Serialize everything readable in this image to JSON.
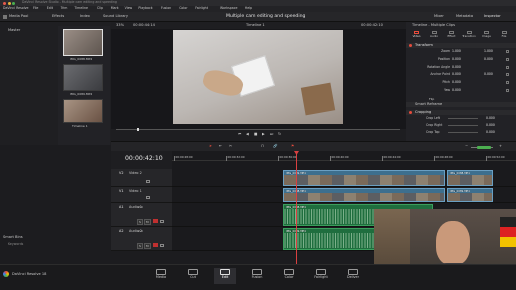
{
  "window": {
    "title": "DaVinci Resolve Studio - Multiple cam editing and speeding"
  },
  "menu": [
    "DaVinci Resolve",
    "File",
    "Edit",
    "Trim",
    "Timeline",
    "Clip",
    "Mark",
    "View",
    "Playback",
    "Fusion",
    "Color",
    "Fairlight",
    "Workspace",
    "Help"
  ],
  "toolbar": {
    "media_pool": "Media Pool",
    "effects": "Effects",
    "index": "Index",
    "sound_library": "Sound Library",
    "project_title": "Multiple cam editing and speeding",
    "mixer": "Mixer",
    "metadata": "Metadata",
    "inspector": "Inspector",
    "zoom": "33%",
    "src_tc": "00:00:44:14",
    "timeline_name": "Timeline 1",
    "rec_tc": "00:00:42:10",
    "inspector_target": "Timeline - Multiple Clips"
  },
  "media_pool": {
    "bin": "Master",
    "clips": [
      {
        "name": "IMG_0088.MP4"
      },
      {
        "name": "IMG_0089.MP4"
      },
      {
        "name": "Timeline 1"
      }
    ],
    "smart_bins": "Smart Bins",
    "smart_item": "Keywords"
  },
  "inspector": {
    "tabs": [
      "Video",
      "Audio",
      "Effect",
      "Transition",
      "Image",
      "File"
    ],
    "transform_header": "Transform",
    "fields": [
      {
        "label": "Zoom",
        "x": "1.000",
        "y": "1.000"
      },
      {
        "label": "Position",
        "x": "0.000",
        "y": "0.000"
      },
      {
        "label": "Rotation Angle",
        "x": "0.000",
        "y": ""
      },
      {
        "label": "Anchor Point",
        "x": "0.000",
        "y": "0.000"
      },
      {
        "label": "Pitch",
        "x": "0.000",
        "y": ""
      },
      {
        "label": "Yaw",
        "x": "0.000",
        "y": ""
      }
    ],
    "flip": "Flip",
    "smart_reframe": "Smart Reframe",
    "cropping_header": "Cropping",
    "crops": [
      {
        "label": "Crop Left",
        "v": "0.000"
      },
      {
        "label": "Crop Right",
        "v": "0.000"
      },
      {
        "label": "Crop Top",
        "v": "0.000"
      }
    ]
  },
  "timeline": {
    "timecode": "00:00:42:10",
    "ruler": [
      "00:00:28:00",
      "00:00:32:00",
      "00:00:36:00",
      "00:00:40:00",
      "00:00:44:00",
      "00:00:48:00",
      "00:00:52:00"
    ],
    "tracks": [
      {
        "id": "V2",
        "name": "Video 2",
        "kind": "video",
        "clips": [
          {
            "name": "IMG_0089.MP4"
          },
          {
            "name": "IMG_0088.MP4"
          }
        ]
      },
      {
        "id": "V1",
        "name": "Video 1",
        "kind": "video",
        "clips": [
          {
            "name": "IMG_0088.MP4"
          },
          {
            "name": "IMG_0089.MP4"
          }
        ]
      },
      {
        "id": "A1",
        "name": "Audio 1",
        "kind": "audio",
        "level": "2.0",
        "clips": [
          {
            "name": "IMG_0088.MP4"
          }
        ]
      },
      {
        "id": "A2",
        "name": "Audio 2",
        "kind": "audio",
        "level": "2.0",
        "clips": [
          {
            "name": "IMG_0089.MP4"
          }
        ]
      }
    ]
  },
  "pages": [
    "Media",
    "Cut",
    "Edit",
    "Fusion",
    "Color",
    "Fairlight",
    "Deliver"
  ],
  "active_page": "Edit",
  "app_badge": "DaVinci Resolve 18",
  "colors": {
    "accent": "#e64b3c",
    "video_clip": "#3d6f8e",
    "audio_clip": "#1f6e3e",
    "playhead": "#d94040"
  }
}
